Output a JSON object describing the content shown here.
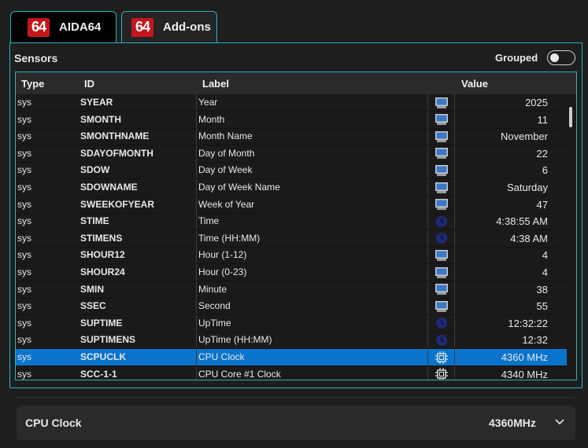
{
  "tabs": [
    {
      "logo": "64",
      "label": "AIDA64"
    },
    {
      "logo": "64",
      "label": "Add-ons"
    }
  ],
  "sensors": {
    "title": "Sensors",
    "grouped_label": "Grouped",
    "grouped": false
  },
  "table": {
    "headers": [
      "Type",
      "ID",
      "Label",
      "Value"
    ],
    "rows": [
      {
        "type": "sys",
        "id": "SYEAR",
        "label": "Year",
        "icon": "monitor-icon",
        "value": "2025"
      },
      {
        "type": "sys",
        "id": "SMONTH",
        "label": "Month",
        "icon": "monitor-icon",
        "value": "11"
      },
      {
        "type": "sys",
        "id": "SMONTHNAME",
        "label": "Month Name",
        "icon": "monitor-icon",
        "value": "November"
      },
      {
        "type": "sys",
        "id": "SDAYOFMONTH",
        "label": "Day of Month",
        "icon": "monitor-icon",
        "value": "22"
      },
      {
        "type": "sys",
        "id": "SDOW",
        "label": "Day of Week",
        "icon": "monitor-icon",
        "value": "6"
      },
      {
        "type": "sys",
        "id": "SDOWNAME",
        "label": "Day of Week Name",
        "icon": "monitor-icon",
        "value": "Saturday"
      },
      {
        "type": "sys",
        "id": "SWEEKOFYEAR",
        "label": "Week of Year",
        "icon": "monitor-icon",
        "value": "47"
      },
      {
        "type": "sys",
        "id": "STIME",
        "label": "Time",
        "icon": "clock-icon",
        "value": "4:38:55 AM"
      },
      {
        "type": "sys",
        "id": "STIMENS",
        "label": "Time (HH:MM)",
        "icon": "clock-icon",
        "value": "4:38 AM"
      },
      {
        "type": "sys",
        "id": "SHOUR12",
        "label": "Hour (1-12)",
        "icon": "monitor-icon",
        "value": "4"
      },
      {
        "type": "sys",
        "id": "SHOUR24",
        "label": "Hour (0-23)",
        "icon": "monitor-icon",
        "value": "4"
      },
      {
        "type": "sys",
        "id": "SMIN",
        "label": "Minute",
        "icon": "monitor-icon",
        "value": "38"
      },
      {
        "type": "sys",
        "id": "SSEC",
        "label": "Second",
        "icon": "monitor-icon",
        "value": "55"
      },
      {
        "type": "sys",
        "id": "SUPTIME",
        "label": "UpTime",
        "icon": "clock-icon",
        "value": "12:32:22"
      },
      {
        "type": "sys",
        "id": "SUPTIMENS",
        "label": "UpTime (HH:MM)",
        "icon": "clock-icon",
        "value": "12:32"
      },
      {
        "type": "sys",
        "id": "SCPUCLK",
        "label": "CPU Clock",
        "icon": "cpu-chip-icon",
        "value": "4360 MHz",
        "selected": true
      },
      {
        "type": "sys",
        "id": "SCC-1-1",
        "label": "CPU Core #1 Clock",
        "icon": "cpu-chip-icon",
        "value": "4340 MHz"
      }
    ]
  },
  "selection": {
    "label": "CPU Clock",
    "value": "4360MHz"
  },
  "colors": {
    "accent": "#2bb3c0",
    "selected_row": "#0a74cc",
    "logo_red": "#c4161c"
  }
}
